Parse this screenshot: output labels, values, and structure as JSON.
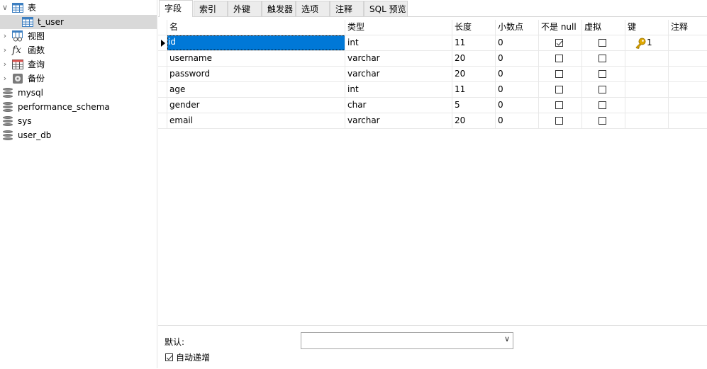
{
  "tree": {
    "tables_label": "表",
    "table_item": "t_user",
    "views_label": "视图",
    "functions_label": "函数",
    "queries_label": "查询",
    "backups_label": "备份",
    "databases": [
      "mysql",
      "performance_schema",
      "sys",
      "user_db"
    ]
  },
  "tabs": [
    "字段",
    "索引",
    "外键",
    "触发器",
    "选项",
    "注释",
    "SQL 预览"
  ],
  "grid": {
    "headers": [
      "名",
      "类型",
      "长度",
      "小数点",
      "不是 null",
      "虚拟",
      "键",
      "注释"
    ],
    "rows": [
      {
        "name": "id",
        "type": "int",
        "length": "11",
        "decimals": "0",
        "not_null": true,
        "virtual": false,
        "key": "1",
        "comment": ""
      },
      {
        "name": "username",
        "type": "varchar",
        "length": "20",
        "decimals": "0",
        "not_null": false,
        "virtual": false,
        "key": "",
        "comment": ""
      },
      {
        "name": "password",
        "type": "varchar",
        "length": "20",
        "decimals": "0",
        "not_null": false,
        "virtual": false,
        "key": "",
        "comment": ""
      },
      {
        "name": "age",
        "type": "int",
        "length": "11",
        "decimals": "0",
        "not_null": false,
        "virtual": false,
        "key": "",
        "comment": ""
      },
      {
        "name": "gender",
        "type": "char",
        "length": "5",
        "decimals": "0",
        "not_null": false,
        "virtual": false,
        "key": "",
        "comment": ""
      },
      {
        "name": "email",
        "type": "varchar",
        "length": "20",
        "decimals": "0",
        "not_null": false,
        "virtual": false,
        "key": "",
        "comment": ""
      }
    ]
  },
  "bottom": {
    "default_label": "默认:",
    "default_value": "",
    "auto_increment_label": "自动递增",
    "auto_increment_checked": true
  },
  "colors": {
    "selection": "#0078d7",
    "tree_selected": "#d9d9d9",
    "key_icon": "#e0a800"
  },
  "icons": [
    "chevron-down-icon",
    "chevron-right-icon",
    "table-icon",
    "view-icon",
    "function-icon",
    "query-icon",
    "backup-icon",
    "database-icon",
    "key-icon",
    "row-marker-icon",
    "dropdown-arrow-icon"
  ]
}
